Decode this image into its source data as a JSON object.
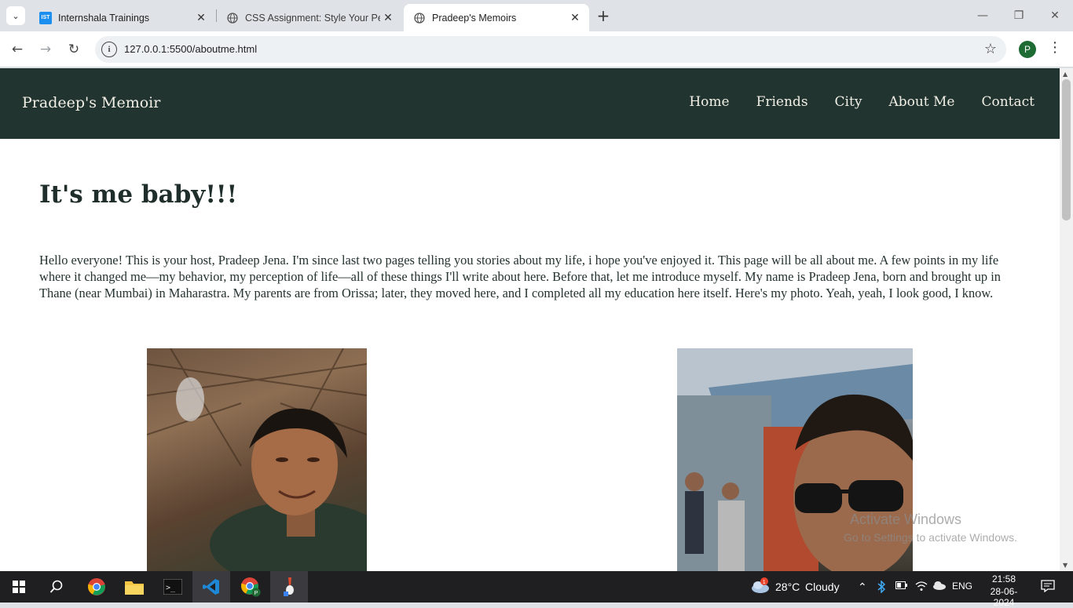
{
  "browser": {
    "tabs": [
      {
        "title": "Internshala Trainings",
        "favicon_text": "IST",
        "favicon_color": "#1b8ff0",
        "active": false
      },
      {
        "title": "CSS Assignment: Style Your Pers",
        "active": false
      },
      {
        "title": "Pradeep's Memoirs",
        "active": true
      }
    ],
    "url": "127.0.0.1:5500/aboutme.html",
    "profile_initial": "P",
    "profile_color": "#1e6b34"
  },
  "site": {
    "brand": "Pradeep's Memoir",
    "nav": [
      "Home",
      "Friends",
      "City",
      "About Me",
      "Contact"
    ],
    "nav_bg": "#213430",
    "heading": "It's me baby!!!",
    "intro": "Hello everyone! This is your host, Pradeep Jena. I'm since last two pages telling you stories about my life, i hope you've enjoyed it. This page will be all about me. A few points in my life where it changed me—my behavior, my perception of life—all of these things I'll write about here. Before that, let me introduce myself. My name is Pradeep Jena, born and brought up in Thane (near Mumbai) in Maharastra. My parents are from Orissa; later, they moved here, and I completed all my education here itself. Here's my photo. Yeah, yeah, I look good, I know."
  },
  "watermark": {
    "line1": "Activate Windows",
    "line2": "Go to Settings to activate Windows."
  },
  "taskbar": {
    "weather_temp": "28°C",
    "weather_desc": "Cloudy",
    "weather_badge": "1",
    "language": "ENG",
    "time": "21:58",
    "date": "28-06-2024"
  }
}
